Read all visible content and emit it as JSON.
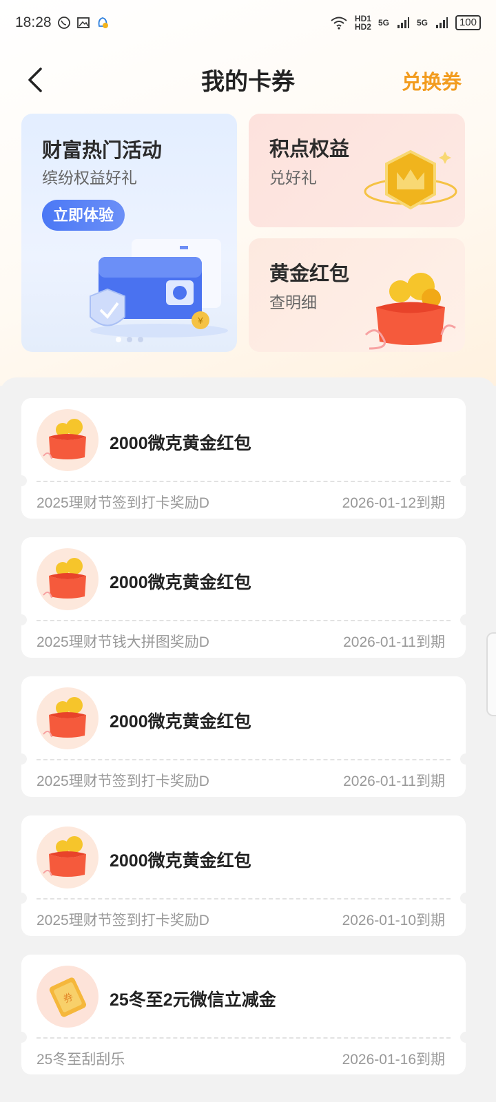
{
  "status_bar": {
    "time": "18:28",
    "network": [
      "HD1",
      "HD2",
      "5G",
      "5G"
    ],
    "battery": "100"
  },
  "header": {
    "title": "我的卡券",
    "exchange_label": "兑换券"
  },
  "banners": {
    "left": {
      "title": "财富热门活动",
      "subtitle": "缤纷权益好礼",
      "button_label": "立即体验"
    },
    "right_top": {
      "title": "积点权益",
      "subtitle": "兑好礼"
    },
    "right_bottom": {
      "title": "黄金红包",
      "subtitle": "查明细"
    }
  },
  "coupons": [
    {
      "title": "2000微克黄金红包",
      "source": "2025理财节签到打卡奖励D",
      "expire": "2026-01-12到期",
      "icon": "red-envelope-icon"
    },
    {
      "title": "2000微克黄金红包",
      "source": "2025理财节钱大拼图奖励D",
      "expire": "2026-01-11到期",
      "icon": "red-envelope-icon"
    },
    {
      "title": "2000微克黄金红包",
      "source": "2025理财节签到打卡奖励D",
      "expire": "2026-01-11到期",
      "icon": "red-envelope-icon"
    },
    {
      "title": "2000微克黄金红包",
      "source": "2025理财节签到打卡奖励D",
      "expire": "2026-01-10到期",
      "icon": "red-envelope-icon"
    },
    {
      "title": "25冬至2元微信立减金",
      "source": "25冬至刮刮乐",
      "expire": "2026-01-16到期",
      "icon": "gold-ticket-icon"
    }
  ],
  "colors": {
    "accent": "#f29c1f",
    "primary_button": "#4b78f5",
    "background": "#f2f2f2"
  }
}
